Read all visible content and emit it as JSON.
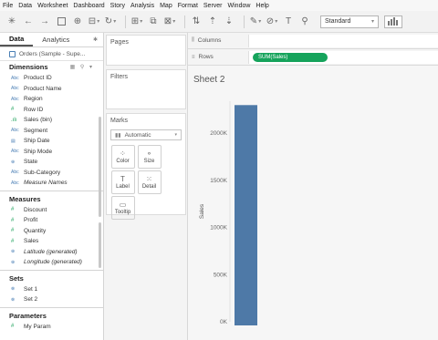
{
  "menu": [
    "File",
    "Data",
    "Worksheet",
    "Dashboard",
    "Story",
    "Analysis",
    "Map",
    "Format",
    "Server",
    "Window",
    "Help"
  ],
  "toolbar": {
    "fit_select": "Standard"
  },
  "datapane": {
    "tabs": [
      "Data",
      "Analytics"
    ],
    "datasource": "Orders (Sample - Supe...",
    "dimensions_title": "Dimensions",
    "dimensions": [
      {
        "icon": "Abc",
        "label": "Product ID"
      },
      {
        "icon": "Abc",
        "label": "Product Name"
      },
      {
        "icon": "Abc",
        "label": "Region"
      },
      {
        "icon": "#",
        "label": "Row ID"
      },
      {
        "icon": "bin",
        "label": "Sales (bin)"
      },
      {
        "icon": "Abc",
        "label": "Segment"
      },
      {
        "icon": "date",
        "label": "Ship Date"
      },
      {
        "icon": "Abc",
        "label": "Ship Mode"
      },
      {
        "icon": "globe",
        "label": "State"
      },
      {
        "icon": "Abc",
        "label": "Sub-Category"
      },
      {
        "icon": "Abc",
        "label": "Measure Names"
      }
    ],
    "measures_title": "Measures",
    "measures": [
      {
        "icon": "#",
        "label": "Discount"
      },
      {
        "icon": "#",
        "label": "Profit"
      },
      {
        "icon": "#",
        "label": "Quantity"
      },
      {
        "icon": "#",
        "label": "Sales"
      },
      {
        "icon": "globe",
        "label": "Latitude (generated)"
      },
      {
        "icon": "globe",
        "label": "Longitude (generated)"
      }
    ],
    "sets_title": "Sets",
    "sets": [
      "Set 1",
      "Set 2"
    ],
    "parameters_title": "Parameters",
    "parameters": [
      "My Param"
    ]
  },
  "cards": {
    "pages": "Pages",
    "filters": "Filters",
    "marks": "Marks",
    "mark_type": "Automatic",
    "mark_buttons": [
      {
        "label": "Color",
        "icon": "color-icon"
      },
      {
        "label": "Size",
        "icon": "size-icon"
      },
      {
        "label": "Label",
        "icon": "label-icon"
      },
      {
        "label": "Detail",
        "icon": "detail-icon"
      },
      {
        "label": "Tooltip",
        "icon": "tooltip-icon"
      }
    ]
  },
  "shelves": {
    "columns": "Columns",
    "rows": "Rows",
    "rows_pill": "SUM(Sales)"
  },
  "view": {
    "sheet_title": "Sheet 2"
  },
  "chart_data": {
    "type": "bar",
    "categories": [
      ""
    ],
    "values": [
      2297201
    ],
    "ylabel": "Sales",
    "ylim": [
      0,
      2300000
    ],
    "yticks": [
      "0K",
      "500K",
      "1000K",
      "1500K",
      "2000K"
    ],
    "ytick_values": [
      0,
      500000,
      1000000,
      1500000,
      2000000
    ],
    "bar_color": "#4e79a7"
  }
}
